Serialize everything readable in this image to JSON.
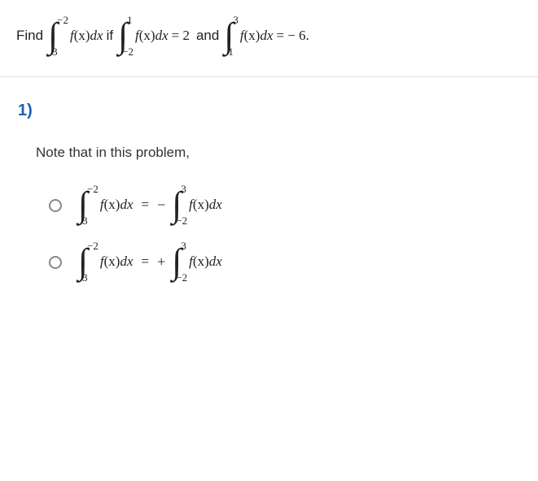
{
  "problem": {
    "lead": "Find",
    "int1": {
      "lower": "3",
      "upper": "−2",
      "expr_f": "f",
      "expr_x": "(x)",
      "expr_d": "d",
      "expr_var": "x"
    },
    "if_word": "if",
    "int2": {
      "lower": "−2",
      "upper": "1",
      "expr_f": "f",
      "expr_x": "(x)",
      "expr_d": "d",
      "expr_var": "x"
    },
    "eq1": "= 2",
    "and_word": "and",
    "int3": {
      "lower": "1",
      "upper": "3",
      "expr_f": "f",
      "expr_x": "(x)",
      "expr_d": "d",
      "expr_var": "x"
    },
    "eq2": "=  − 6."
  },
  "question_number": "1)",
  "note": "Note that in this problem,",
  "options": [
    {
      "left": {
        "lower": "3",
        "upper": "−2",
        "expr_f": "f",
        "expr_x": "(x)",
        "expr_d": "d",
        "expr_var": "x"
      },
      "eq": "=",
      "sign": "−",
      "right": {
        "lower": "−2",
        "upper": "3",
        "expr_f": "f",
        "expr_x": "(x)",
        "expr_d": "d",
        "expr_var": "x"
      }
    },
    {
      "left": {
        "lower": "3",
        "upper": "−2",
        "expr_f": "f",
        "expr_x": "(x)",
        "expr_d": "d",
        "expr_var": "x"
      },
      "eq": "=",
      "sign": "+",
      "right": {
        "lower": "−2",
        "upper": "3",
        "expr_f": "f",
        "expr_x": "(x)",
        "expr_d": "d",
        "expr_var": "x"
      }
    }
  ]
}
